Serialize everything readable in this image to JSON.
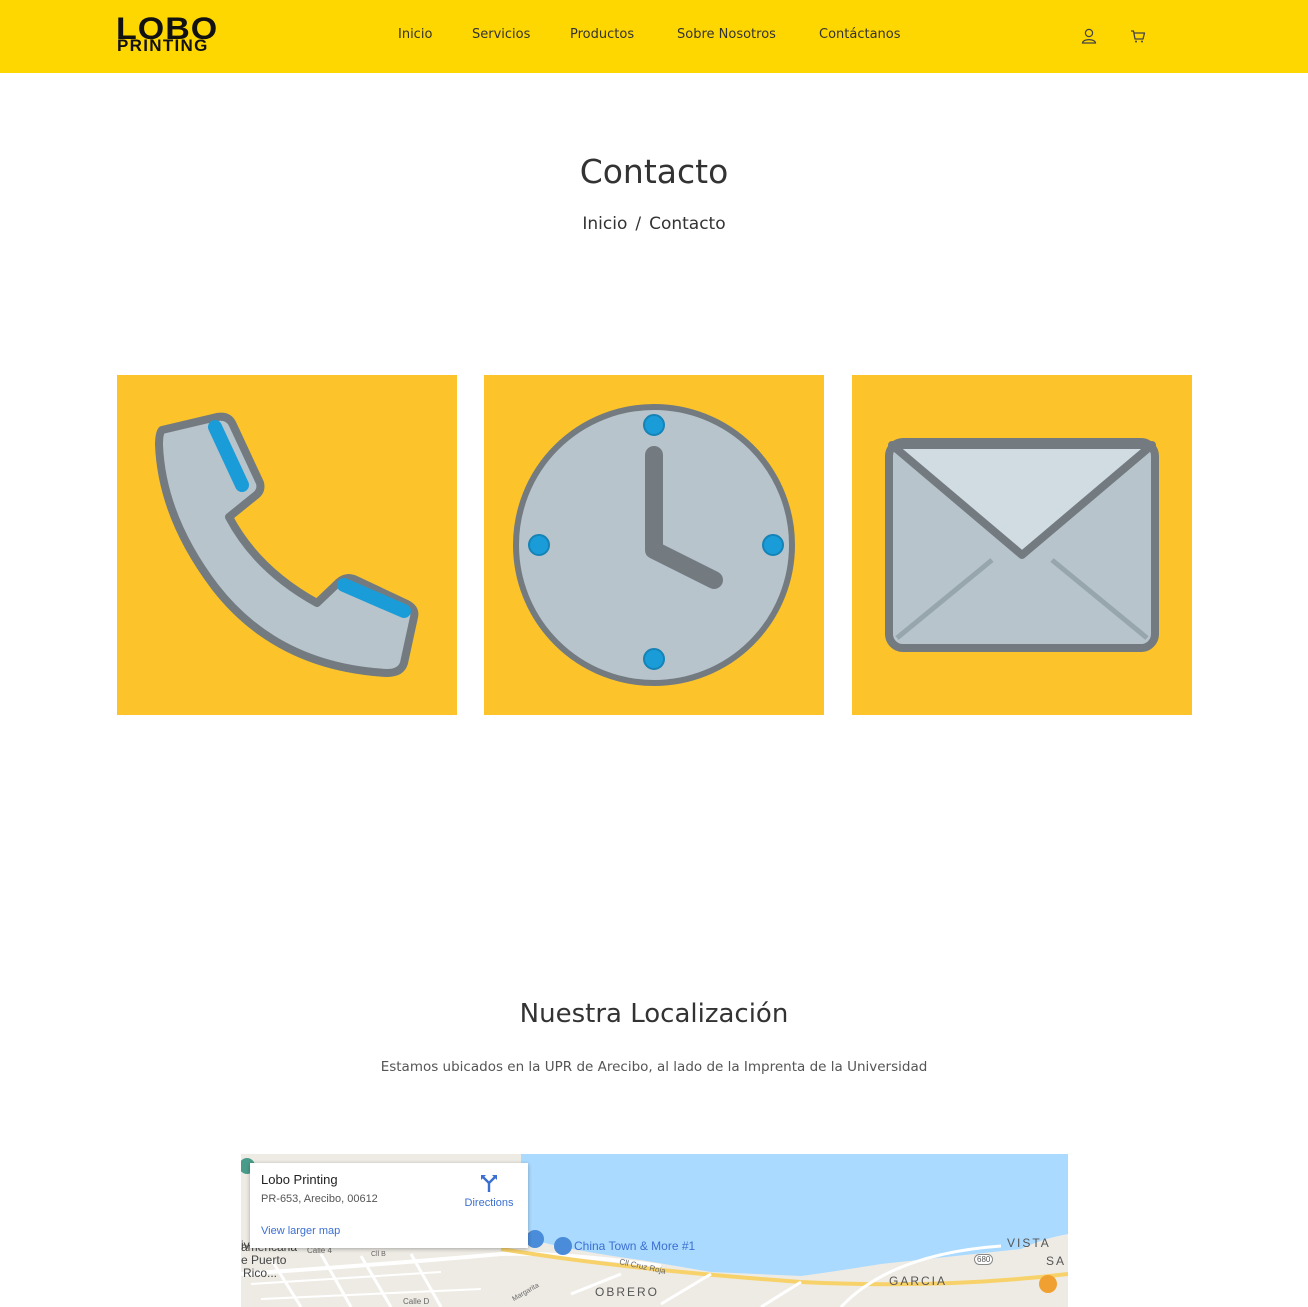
{
  "header": {
    "logo_top": "LOBO",
    "logo_bottom": "PRINTING",
    "nav": [
      "Inicio",
      "Servicios",
      "Productos",
      "Sobre Nosotros",
      "Contáctanos"
    ],
    "icons": [
      "user-icon",
      "cart-icon"
    ],
    "background": "#ffd700"
  },
  "page": {
    "title": "Contacto",
    "breadcrumb": [
      "Inicio",
      "/",
      "Contacto"
    ]
  },
  "cards": [
    {
      "icon": "phone-icon"
    },
    {
      "icon": "clock-icon"
    },
    {
      "icon": "envelope-icon"
    }
  ],
  "colors": {
    "card_bg": "#fcc42a",
    "icon_fill": "#b7c4cc",
    "icon_stroke": "#737b80",
    "icon_accent": "#1a9cd8"
  },
  "location": {
    "title": "Nuestra Localización",
    "text": "Estamos ubicados en la UPR de Arecibo, al lado de la Imprenta de la Universidad"
  },
  "map": {
    "place_name": "Lobo Printing",
    "address": "PR-653, Arecibo, 00612",
    "directions": "Directions",
    "larger_map": "View larger map",
    "labels": {
      "china_town": "China Town & More #1",
      "obrero": "OBRERO",
      "garcia": "GARCIA",
      "vista": "VISTA",
      "sa": "SA",
      "route": "680",
      "cruz_roja": "Cll Cruz Roja",
      "calle_d": "Calle D",
      "calle_4": "Calle 4",
      "calle_b": "Cll B",
      "puerto_a": "americana",
      "puerto_b": "e Puerto",
      "puerto_c": "Rico...",
      "iv": "iv",
      "margarita": "Margarita"
    }
  }
}
